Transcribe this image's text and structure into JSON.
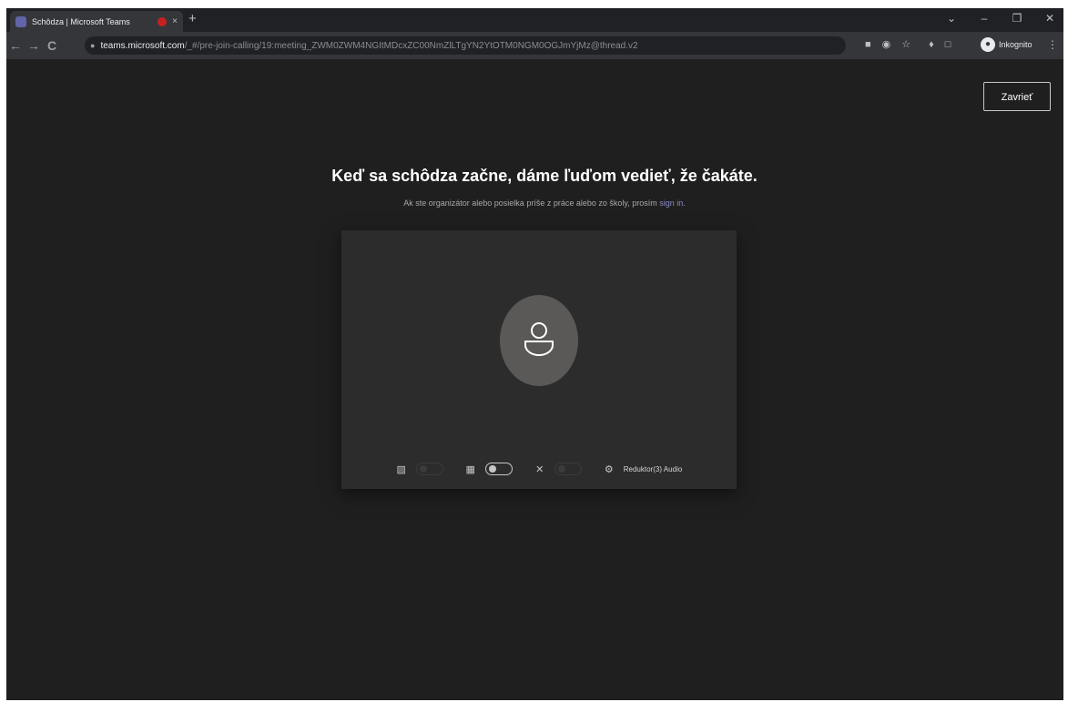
{
  "browser": {
    "tab": {
      "title": "Schôdza | Microsoft Teams",
      "close_glyph": "×"
    },
    "new_tab_glyph": "+",
    "window_controls": {
      "chevron": "⌄",
      "minimize": "–",
      "maximize": "❐",
      "close": "✕"
    },
    "nav": {
      "back": "←",
      "forward": "→",
      "reload": "C"
    },
    "address": {
      "domain": "teams.microsoft.com",
      "path": "/_#/pre-join-calling/19:meeting_ZWM0ZWM4NGItMDcxZC00NmZlLTgYN2YtOTM0NGM0OGJmYjMz@thread.v2"
    },
    "profile_label": "Inkognito",
    "menu_glyph": "⋮"
  },
  "page": {
    "close_button": "Zavrieť",
    "heading": "Keď sa schôdza začne, dáme ľuďom vedieť, že čakáte.",
    "subtext_prefix": "Ak ste organizátor alebo posielka príše z práce alebo zo školy, prosím ",
    "signin_link": "sign in.",
    "audio_label": "Reduktor(3) Audio"
  },
  "icons": {
    "tab_favicon": "teams-icon",
    "recording": "record-icon",
    "lock": "lock-icon",
    "camera_off": "camera-off-icon",
    "blur": "background-blur-icon",
    "mic_off": "mic-off-icon",
    "gear": "gear-icon",
    "avatar": "person-icon"
  },
  "colors": {
    "page_bg": "#1f1f1f",
    "card_bg": "#2d2c2c",
    "accent_link": "#8b8cc7",
    "avatar_bg": "#5a5958"
  }
}
